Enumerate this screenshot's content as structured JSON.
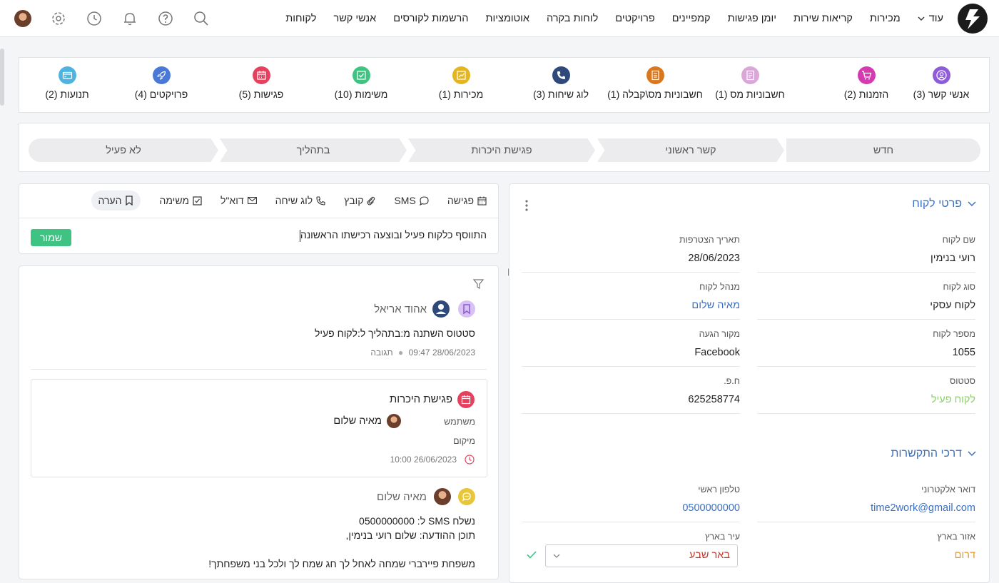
{
  "nav": {
    "items": [
      "לקוחות",
      "אנשי קשר",
      "הרשמות לקורסים",
      "אוטומציות",
      "לוחות בקרה",
      "פרויקטים",
      "קמפיינים",
      "יומן פגישות",
      "קריאות שירות",
      "מכירות"
    ],
    "more_label": "עוד"
  },
  "related": [
    {
      "label": "אנשי קשר (3)",
      "icon": "user-circle-icon",
      "color": "#8e5bd9"
    },
    {
      "label": "הזמנות (2)",
      "icon": "cart-icon",
      "color": "#d63ab0"
    },
    {
      "label": "חשבוניות מס (1)",
      "icon": "document-icon",
      "color": "#dba7d9"
    },
    {
      "label": "חשבוניות מס\\קבלה (1)",
      "icon": "receipt-icon",
      "color": "#d9771f"
    },
    {
      "label": "לוג שיחות (3)",
      "icon": "phone-icon",
      "color": "#2f4a7a"
    },
    {
      "label": "מכירות (1)",
      "icon": "trend-icon",
      "color": "#e3b51e"
    },
    {
      "label": "משימות (10)",
      "icon": "check-icon",
      "color": "#3fc383"
    },
    {
      "label": "פגישות (5)",
      "icon": "calendar-icon",
      "color": "#e5405e"
    },
    {
      "label": "פרויקטים (4)",
      "icon": "rocket-icon",
      "color": "#4978d6"
    },
    {
      "label": "תנועות (2)",
      "icon": "card-icon",
      "color": "#4fb3e0"
    }
  ],
  "pipeline": [
    "חדש",
    "קשר ראשוני",
    "פגישת היכרות",
    "בתהליך",
    "לא פעיל"
  ],
  "actions": {
    "tabs": [
      {
        "label": "הערה",
        "icon": "bookmark-icon"
      },
      {
        "label": "משימה",
        "icon": "checkbox-icon"
      },
      {
        "label": "דוא\"ל",
        "icon": "mail-icon"
      },
      {
        "label": "לוג שיחה",
        "icon": "phone-icon"
      },
      {
        "label": "קובץ",
        "icon": "paperclip-icon"
      },
      {
        "label": "SMS",
        "icon": "chat-icon"
      },
      {
        "label": "פגישה",
        "icon": "calendar-icon"
      }
    ],
    "note_text": "התווסף כלקוח פעיל ובוצעה רכישתו הראשונה",
    "save_label": "שמור"
  },
  "feed": {
    "entry1": {
      "author": "אהוד אריאל",
      "text": "סטטוס השתנה מ:בתהליך ל:לקוח פעיל",
      "timestamp": "28/06/2023 09:47",
      "reply": "תגובה"
    },
    "meeting": {
      "title": "פגישת היכרות",
      "user_label": "משתמש",
      "user_name": "מאיה שלום",
      "location_label": "מיקום",
      "time": "26/06/2023 10:00"
    },
    "entry2": {
      "author": "מאיה שלום",
      "line1": "נשלח SMS ל: 0500000000",
      "line2": "תוכן ההודעה: שלום  רועי בנימין,",
      "line3": "משפחת פיירברי שמחה לאחל לך חג שמח לך ולכל בני משפחתך!"
    }
  },
  "details": {
    "customer_title": "פרטי לקוח",
    "fields": [
      {
        "label": "שם לקוח",
        "value": "רועי בנימין",
        "style": ""
      },
      {
        "label": "תאריך הצטרפות",
        "value": "28/06/2023",
        "style": ""
      },
      {
        "label": "סוג לקוח",
        "value": "לקוח עסקי",
        "style": ""
      },
      {
        "label": "מנהל לקוח",
        "value": "מאיה שלום",
        "style": "link"
      },
      {
        "label": "מספר לקוח",
        "value": "1055",
        "style": ""
      },
      {
        "label": "מקור הגעה",
        "value": "Facebook",
        "style": ""
      },
      {
        "label": "סטטוס",
        "value": "לקוח פעיל",
        "style": "green"
      },
      {
        "label": "ח.פ.",
        "value": "625258774",
        "style": ""
      }
    ],
    "contact_title": "דרכי התקשרות",
    "contact": {
      "email_label": "דואר אלקטרוני",
      "email": "time2work@gmail.com",
      "phone_label": "טלפון ראשי",
      "phone": "0500000000",
      "region_label": "אזור בארץ",
      "region": "דרום",
      "city_label": "עיר בארץ",
      "city": "באר שבע"
    }
  }
}
